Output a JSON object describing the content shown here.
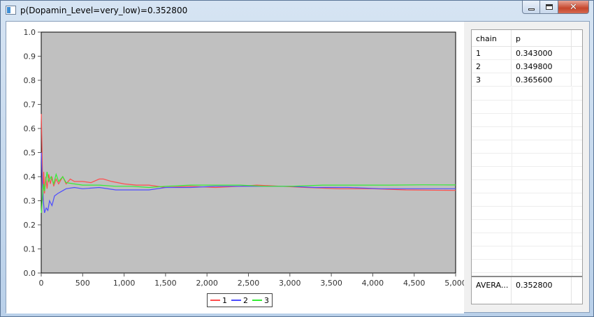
{
  "window": {
    "title": "p(Dopamin_Level=very_low)=0.352800",
    "buttons": {
      "minimize": "minimize",
      "maximize": "maximize",
      "close": "✕"
    }
  },
  "chart_data": {
    "type": "line",
    "title": "",
    "xlabel": "",
    "ylabel": "",
    "xlim": [
      0,
      5000
    ],
    "ylim": [
      0.0,
      1.0
    ],
    "x_ticks": [
      "0",
      "500",
      "1,000",
      "1,500",
      "2,000",
      "2,500",
      "3,000",
      "3,500",
      "4,000",
      "4,500",
      "5,000"
    ],
    "y_ticks": [
      "0.0",
      "0.1",
      "0.2",
      "0.3",
      "0.4",
      "0.5",
      "0.6",
      "0.7",
      "0.8",
      "0.9",
      "1.0"
    ],
    "plot_background": "#c0c0c0",
    "legend_placement": "bottom-center",
    "series": [
      {
        "name": "1",
        "color": "#ff4d4d",
        "points": [
          [
            1,
            0.66
          ],
          [
            10,
            0.5
          ],
          [
            20,
            0.3
          ],
          [
            30,
            0.42
          ],
          [
            40,
            0.33
          ],
          [
            55,
            0.4
          ],
          [
            70,
            0.35
          ],
          [
            90,
            0.41
          ],
          [
            110,
            0.37
          ],
          [
            130,
            0.4
          ],
          [
            150,
            0.36
          ],
          [
            180,
            0.39
          ],
          [
            210,
            0.37
          ],
          [
            260,
            0.4
          ],
          [
            300,
            0.37
          ],
          [
            350,
            0.39
          ],
          [
            400,
            0.38
          ],
          [
            500,
            0.38
          ],
          [
            600,
            0.375
          ],
          [
            700,
            0.39
          ],
          [
            750,
            0.39
          ],
          [
            850,
            0.38
          ],
          [
            1000,
            0.37
          ],
          [
            1150,
            0.365
          ],
          [
            1300,
            0.365
          ],
          [
            1500,
            0.355
          ],
          [
            1800,
            0.36
          ],
          [
            2100,
            0.355
          ],
          [
            2400,
            0.36
          ],
          [
            2600,
            0.365
          ],
          [
            2900,
            0.36
          ],
          [
            3200,
            0.355
          ],
          [
            3600,
            0.35
          ],
          [
            4000,
            0.35
          ],
          [
            4400,
            0.345
          ],
          [
            5000,
            0.343
          ]
        ]
      },
      {
        "name": "2",
        "color": "#4d4dff",
        "points": [
          [
            1,
            0.5
          ],
          [
            10,
            0.4
          ],
          [
            25,
            0.3
          ],
          [
            40,
            0.25
          ],
          [
            60,
            0.27
          ],
          [
            80,
            0.26
          ],
          [
            100,
            0.3
          ],
          [
            130,
            0.28
          ],
          [
            160,
            0.32
          ],
          [
            200,
            0.33
          ],
          [
            250,
            0.34
          ],
          [
            300,
            0.35
          ],
          [
            400,
            0.355
          ],
          [
            500,
            0.35
          ],
          [
            700,
            0.355
          ],
          [
            900,
            0.345
          ],
          [
            1100,
            0.345
          ],
          [
            1300,
            0.345
          ],
          [
            1500,
            0.355
          ],
          [
            1800,
            0.355
          ],
          [
            2100,
            0.36
          ],
          [
            2400,
            0.36
          ],
          [
            2700,
            0.36
          ],
          [
            3000,
            0.36
          ],
          [
            3300,
            0.355
          ],
          [
            3700,
            0.355
          ],
          [
            4100,
            0.35
          ],
          [
            4500,
            0.35
          ],
          [
            5000,
            0.3498
          ]
        ]
      },
      {
        "name": "3",
        "color": "#33ee33",
        "points": [
          [
            1,
            0.25
          ],
          [
            10,
            0.3
          ],
          [
            25,
            0.37
          ],
          [
            40,
            0.34
          ],
          [
            55,
            0.38
          ],
          [
            70,
            0.42
          ],
          [
            90,
            0.38
          ],
          [
            120,
            0.4
          ],
          [
            150,
            0.37
          ],
          [
            180,
            0.41
          ],
          [
            210,
            0.38
          ],
          [
            260,
            0.4
          ],
          [
            300,
            0.375
          ],
          [
            400,
            0.37
          ],
          [
            500,
            0.365
          ],
          [
            700,
            0.365
          ],
          [
            900,
            0.36
          ],
          [
            1100,
            0.36
          ],
          [
            1300,
            0.355
          ],
          [
            1500,
            0.36
          ],
          [
            1800,
            0.365
          ],
          [
            2100,
            0.365
          ],
          [
            2400,
            0.365
          ],
          [
            2700,
            0.36
          ],
          [
            3000,
            0.36
          ],
          [
            3400,
            0.365
          ],
          [
            3800,
            0.365
          ],
          [
            4200,
            0.365
          ],
          [
            4600,
            0.366
          ],
          [
            5000,
            0.3656
          ]
        ]
      }
    ]
  },
  "legend": {
    "items": [
      {
        "label": "1",
        "color": "#ff4d4d"
      },
      {
        "label": "2",
        "color": "#4d4dff"
      },
      {
        "label": "3",
        "color": "#33ee33"
      }
    ]
  },
  "table": {
    "headers": [
      "chain",
      "p"
    ],
    "rows": [
      {
        "chain": "1",
        "p": "0.343000"
      },
      {
        "chain": "2",
        "p": "0.349800"
      },
      {
        "chain": "3",
        "p": "0.365600"
      }
    ],
    "footer": {
      "label": "AVERA...",
      "value": "0.352800"
    }
  }
}
